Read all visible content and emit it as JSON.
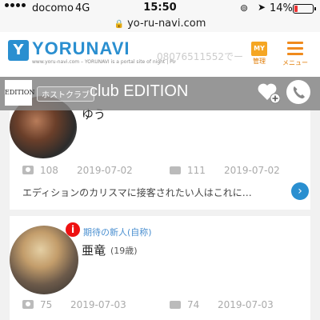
{
  "status_bar": {
    "carrier": "docomo",
    "network": "4G",
    "time": "15:50",
    "battery": "14%"
  },
  "url_bar": {
    "url": "yo-ru-navi.com"
  },
  "header": {
    "logo_letter": "Y",
    "logo_text": "YORUNAVI",
    "tagline": "www.yoru-navi.com – YORUNAVI is a portal site of night | Powered by TEAMRECT Inc.",
    "phone": "08076511552でー",
    "my_icon_text": "MY",
    "my_label": "管理",
    "menu_label": "メニュー"
  },
  "club": {
    "logo_text": "EDITION",
    "category": "ホストクラブ",
    "name": "club EDITION"
  },
  "cards": [
    {
      "name": "ゆう",
      "photo_count": "108",
      "photo_date": "2019-07-02",
      "comment_count": "111",
      "comment_date": "2019-07-02",
      "description": "エディションのカリスマに接客されたい人はこれに…"
    },
    {
      "badge": "i",
      "new_label": "期待の新人(自称)",
      "name": "亜竜",
      "age": "(19歳)",
      "photo_count": "75",
      "photo_date": "2019-07-03",
      "comment_count": "74",
      "comment_date": "2019-07-03"
    }
  ],
  "colors": {
    "brand_blue": "#2a8fd0",
    "menu_orange": "#f08a1d",
    "badge_red": "#e11111"
  }
}
